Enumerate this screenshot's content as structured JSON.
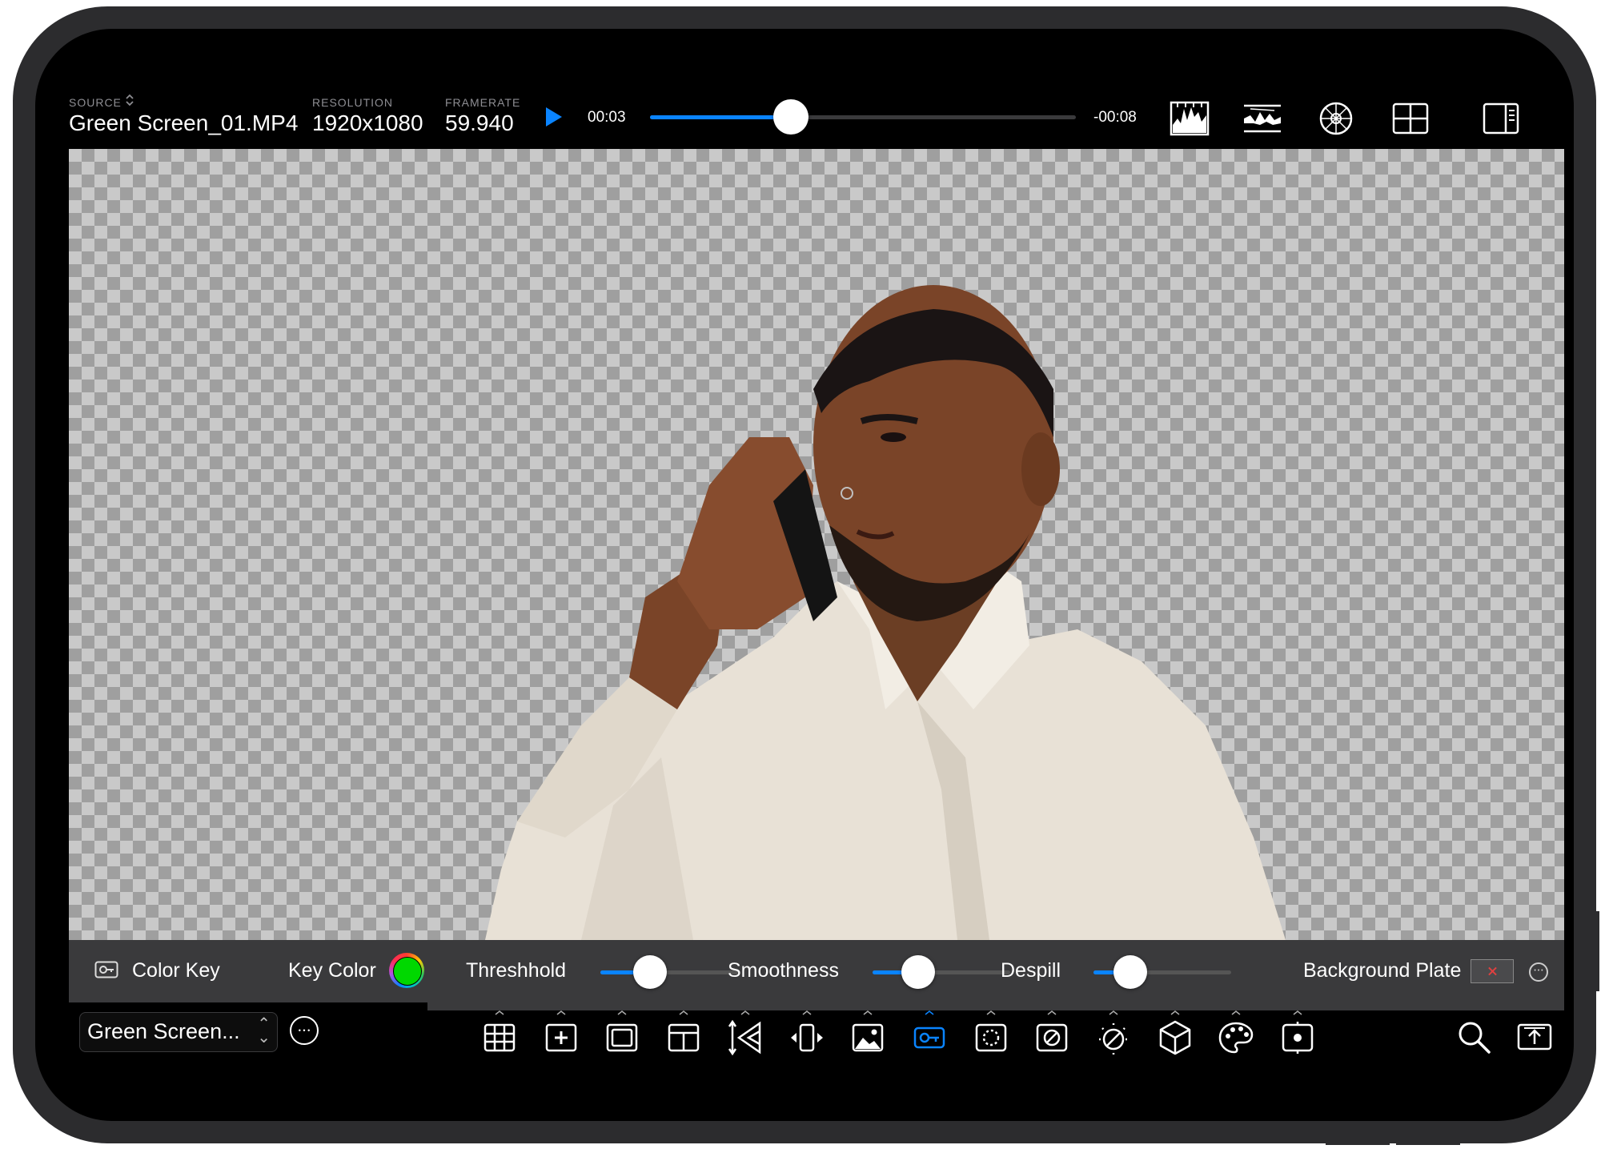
{
  "header": {
    "source_label": "SOURCE",
    "source_value": "Green Screen_01.MP4",
    "resolution_label": "RESOLUTION",
    "resolution_value": "1920x1080",
    "framerate_label": "FRAMERATE",
    "framerate_value": "59.940",
    "time_elapsed": "00:03",
    "time_remaining": "-00:08",
    "playhead_progress": 0.33,
    "right_icons": [
      "histogram-icon",
      "waveform-icon",
      "vectorscope-icon",
      "quad-view-icon",
      "sidebar-toggle-icon"
    ]
  },
  "key_panel": {
    "title": "Color Key",
    "key_color_label": "Key Color",
    "key_color": "#00d800",
    "threshold_label": "Threshhold",
    "threshold_value": 0.36,
    "smoothness_label": "Smoothness",
    "smoothness_value": 0.33,
    "despill_label": "Despill",
    "despill_value": 0.27,
    "background_plate_label": "Background Plate"
  },
  "toolbar": {
    "document_name": "Green Screen...",
    "tools": [
      "grid-icon",
      "crosshair-add-icon",
      "frame-icon",
      "layout-icon",
      "perspective-icon",
      "flip-icon",
      "image-icon",
      "color-key-icon",
      "mask-icon",
      "no-entry-icon",
      "exposure-icon",
      "cube-icon",
      "palette-icon",
      "focus-icon"
    ],
    "active_tool": "color-key-icon"
  },
  "colors": {
    "accent": "#0a84ff",
    "panel": "#3a3a3c",
    "background": "#000000"
  }
}
